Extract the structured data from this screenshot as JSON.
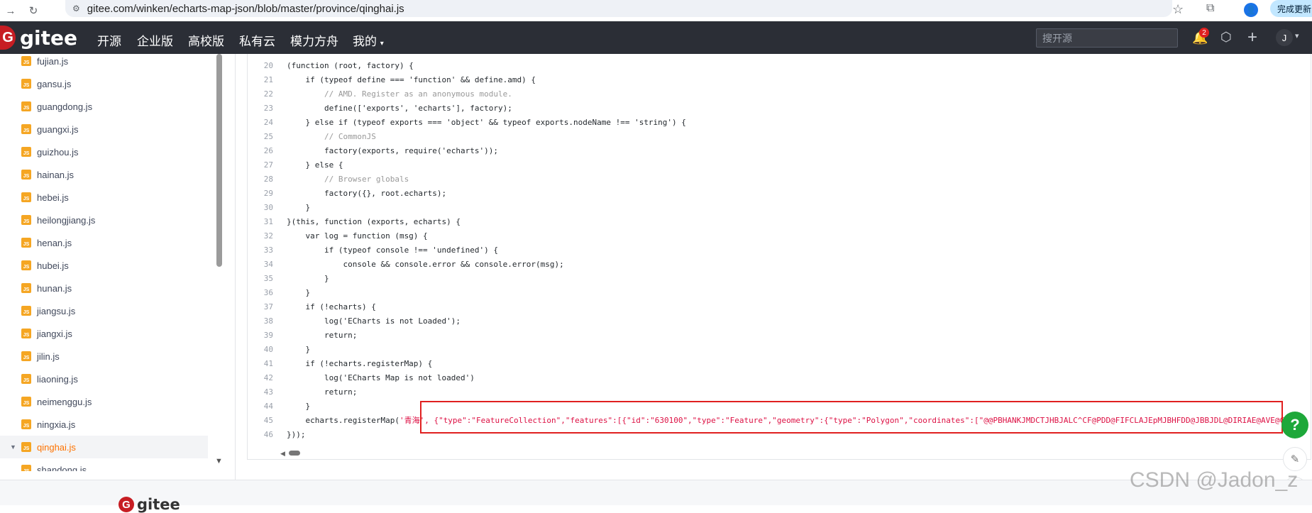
{
  "browser": {
    "url": "gitee.com/winken/echarts-map-json/blob/master/province/qinghai.js",
    "update_label": "完成更新",
    "profile_initial": ""
  },
  "navbar": {
    "logo_text": "gitee",
    "logo_mark": "G",
    "items": [
      "开源",
      "企业版",
      "高校版",
      "私有云",
      "模力方舟",
      "我的"
    ],
    "search_placeholder": "搜开源",
    "notification_count": "2",
    "avatar_initial": "J"
  },
  "sidebar": {
    "files": [
      "fujian.js",
      "gansu.js",
      "guangdong.js",
      "guangxi.js",
      "guizhou.js",
      "hainan.js",
      "hebei.js",
      "heilongjiang.js",
      "henan.js",
      "hubei.js",
      "hunan.js",
      "jiangsu.js",
      "jiangxi.js",
      "jilin.js",
      "liaoning.js",
      "neimenggu.js",
      "ningxia.js",
      "qinghai.js",
      "shandong.js"
    ],
    "active_file": "qinghai.js",
    "file_icon_text": "JS"
  },
  "code": {
    "lines": [
      {
        "n": "20",
        "t": "(function (root, factory) {"
      },
      {
        "n": "21",
        "t": "    if (typeof define === 'function' && define.amd) {"
      },
      {
        "n": "22",
        "t": "        // AMD. Register as an anonymous module."
      },
      {
        "n": "23",
        "t": "        define(['exports', 'echarts'], factory);"
      },
      {
        "n": "24",
        "t": "    } else if (typeof exports === 'object' && typeof exports.nodeName !== 'string') {"
      },
      {
        "n": "25",
        "t": "        // CommonJS"
      },
      {
        "n": "26",
        "t": "        factory(exports, require('echarts'));"
      },
      {
        "n": "27",
        "t": "    } else {"
      },
      {
        "n": "28",
        "t": "        // Browser globals"
      },
      {
        "n": "29",
        "t": "        factory({}, root.echarts);"
      },
      {
        "n": "30",
        "t": "    }"
      },
      {
        "n": "31",
        "t": "}(this, function (exports, echarts) {"
      },
      {
        "n": "32",
        "t": "    var log = function (msg) {"
      },
      {
        "n": "33",
        "t": "        if (typeof console !== 'undefined') {"
      },
      {
        "n": "34",
        "t": "            console && console.error && console.error(msg);"
      },
      {
        "n": "35",
        "t": "        }"
      },
      {
        "n": "36",
        "t": "    }"
      },
      {
        "n": "37",
        "t": "    if (!echarts) {"
      },
      {
        "n": "38",
        "t": "        log('ECharts is not Loaded');"
      },
      {
        "n": "39",
        "t": "        return;"
      },
      {
        "n": "40",
        "t": "    }"
      },
      {
        "n": "41",
        "t": "    if (!echarts.registerMap) {"
      },
      {
        "n": "42",
        "t": "        log('ECharts Map is not loaded')"
      },
      {
        "n": "43",
        "t": "        return;"
      },
      {
        "n": "44",
        "t": "    }"
      },
      {
        "n": "45",
        "t": "    echarts.registerMap('青海', {\"type\":\"FeatureCollection\",\"features\":[{\"id\":\"630100\",\"type\":\"Feature\",\"geometry\":{\"type\":\"Polygon\",\"coordinates\":[\"@@PBHANKJMDCTJHBJALC^CF@PDD@FIFCLAJEpMJBHFDD@JBBJDL@DIRIAE@AVE@CD"
      },
      {
        "n": "46",
        "t": "}));"
      }
    ]
  },
  "highlight_color": "#e02020",
  "footer": {
    "logo_text": "gitee",
    "logo_mark": "G"
  },
  "watermark": "CSDN @Jadon_z"
}
